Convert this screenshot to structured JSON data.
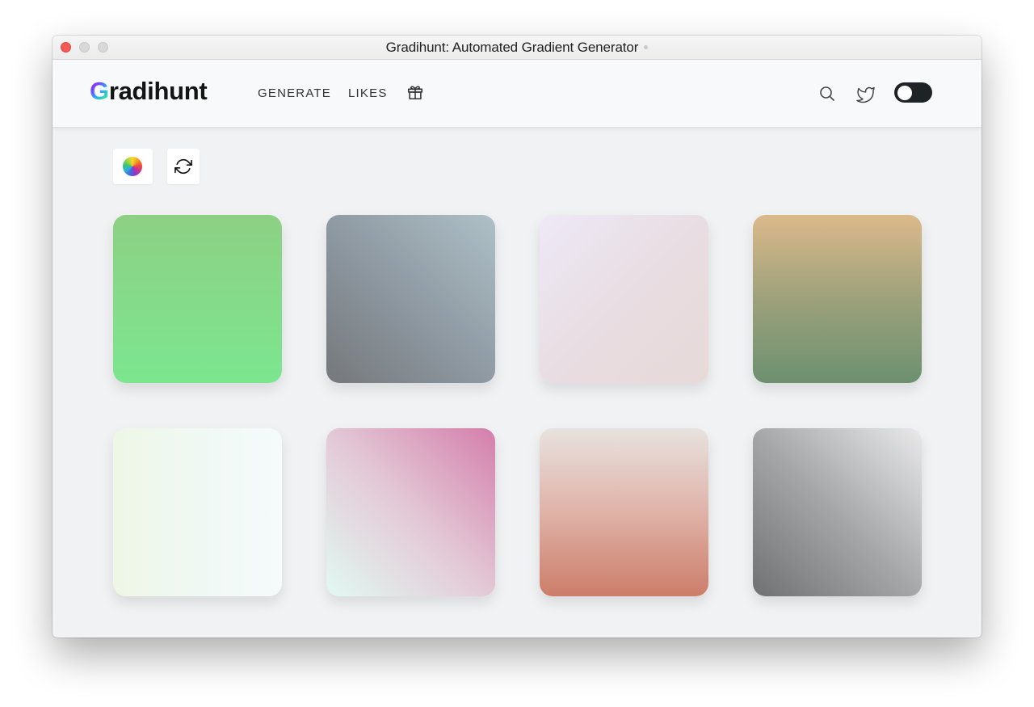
{
  "window": {
    "title": "Gradihunt: Automated Gradient Generator"
  },
  "nav": {
    "logo_first": "G",
    "logo_rest": "radihunt",
    "links": [
      "GENERATE",
      "LIKES"
    ],
    "icons": [
      "gift-icon",
      "search-icon",
      "twitter-icon"
    ],
    "theme_toggle": "dark-mode-toggle"
  },
  "toolbar": {
    "icons": [
      "color-wheel-icon",
      "refresh-icon"
    ]
  },
  "gradients": [
    {
      "colors": [
        "#8dd084",
        "#7ce68f"
      ],
      "direction": "to bottom"
    },
    {
      "colors": [
        "#75787b",
        "#8f9aa3",
        "#aec0c7"
      ],
      "direction": "to top right"
    },
    {
      "colors": [
        "#eee9f7",
        "#e8dde2",
        "#e7d9d8"
      ],
      "direction": "to bottom right"
    },
    {
      "colors": [
        "#dcb98b",
        "#9da17b",
        "#6c9070"
      ],
      "direction": "to bottom"
    },
    {
      "colors": [
        "#eef7e5",
        "#f0f8f4",
        "#f5fbfb"
      ],
      "direction": "to right"
    },
    {
      "colors": [
        "#e2f9f2",
        "#e3c8d6",
        "#d47eab"
      ],
      "direction": "to top right"
    },
    {
      "colors": [
        "#e8e2df",
        "#dfb2a8",
        "#cc7d69"
      ],
      "direction": "to bottom"
    },
    {
      "colors": [
        "#6f7173",
        "#a6a7a9",
        "#e9e9ea"
      ],
      "direction": "to top right"
    }
  ],
  "accent_colors": {
    "close": "#f25a55",
    "toggle": "#1e2326"
  }
}
